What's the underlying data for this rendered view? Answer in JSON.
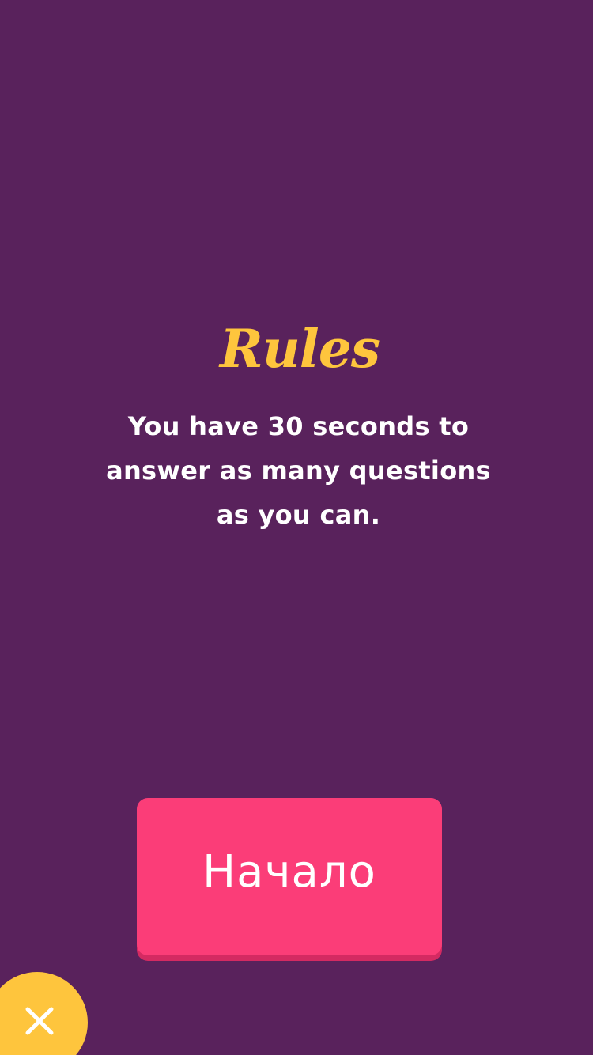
{
  "rules": {
    "title": "Rules",
    "text": "You have 30 seconds to answer as many questions as you can."
  },
  "start_button": {
    "label": "Начало"
  },
  "close_button": {
    "icon": "close-icon"
  },
  "colors": {
    "background": "#59225c",
    "title": "#fec53d",
    "button": "#fb3d78",
    "button_shadow": "#d42a62",
    "close_button": "#fec53d",
    "text": "#ffffff"
  }
}
